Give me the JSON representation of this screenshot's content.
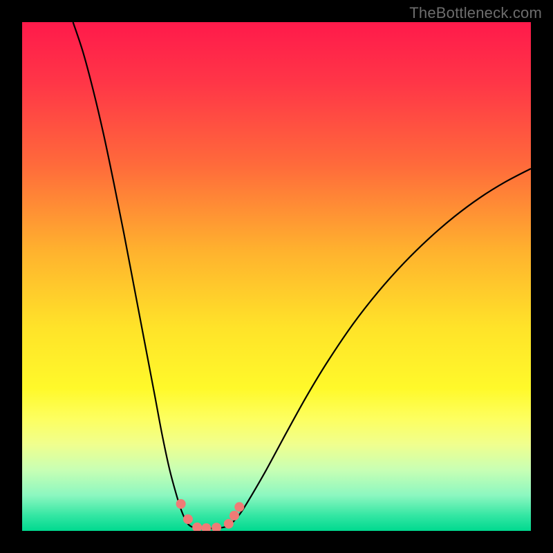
{
  "watermark": "TheBottleneck.com",
  "chart_data": {
    "type": "line",
    "title": "",
    "xlabel": "",
    "ylabel": "",
    "xlim": [
      0,
      100
    ],
    "ylim": [
      0,
      100
    ],
    "grid": false,
    "background": {
      "type": "vertical-gradient",
      "stops": [
        {
          "offset": 0.0,
          "color": "#ff1a4b"
        },
        {
          "offset": 0.12,
          "color": "#ff3647"
        },
        {
          "offset": 0.28,
          "color": "#ff6a3b"
        },
        {
          "offset": 0.45,
          "color": "#ffb22e"
        },
        {
          "offset": 0.6,
          "color": "#ffe329"
        },
        {
          "offset": 0.72,
          "color": "#fff92a"
        },
        {
          "offset": 0.78,
          "color": "#fdff60"
        },
        {
          "offset": 0.83,
          "color": "#f0ff8e"
        },
        {
          "offset": 0.88,
          "color": "#c8ffb4"
        },
        {
          "offset": 0.93,
          "color": "#8cf7c0"
        },
        {
          "offset": 0.97,
          "color": "#33e6a3"
        },
        {
          "offset": 1.0,
          "color": "#00d98f"
        }
      ]
    },
    "series": [
      {
        "name": "left-branch",
        "stroke": "#000000",
        "x": [
          10.0,
          12.0,
          14.0,
          16.0,
          18.0,
          20.0,
          22.0,
          24.0,
          26.0,
          27.5,
          29.0,
          30.5,
          31.5,
          32.5,
          33.3
        ],
        "y": [
          100.0,
          94.0,
          86.5,
          78.0,
          68.5,
          58.5,
          48.0,
          37.5,
          27.0,
          19.0,
          12.0,
          6.5,
          3.5,
          1.5,
          0.8
        ]
      },
      {
        "name": "right-branch",
        "stroke": "#000000",
        "x": [
          40.5,
          41.5,
          43.0,
          45.0,
          48.0,
          52.0,
          56.0,
          60.0,
          65.0,
          70.0,
          75.0,
          80.0,
          85.0,
          90.0,
          95.0,
          100.0
        ],
        "y": [
          0.9,
          1.8,
          3.6,
          6.8,
          12.0,
          19.4,
          26.6,
          33.2,
          40.6,
          47.0,
          52.6,
          57.5,
          61.8,
          65.5,
          68.6,
          71.2
        ]
      },
      {
        "name": "trough-floor",
        "stroke": "#000000",
        "x": [
          33.3,
          35.0,
          37.0,
          39.0,
          40.5
        ],
        "y": [
          0.8,
          0.5,
          0.5,
          0.6,
          0.9
        ]
      }
    ],
    "markers": [
      {
        "series": "trough-markers",
        "color": "#ef7b76",
        "radius": 7,
        "points": [
          {
            "x": 31.2,
            "y": 5.3
          },
          {
            "x": 32.6,
            "y": 2.3
          },
          {
            "x": 34.4,
            "y": 0.7
          },
          {
            "x": 36.2,
            "y": 0.55
          },
          {
            "x": 38.2,
            "y": 0.65
          },
          {
            "x": 40.6,
            "y": 1.4
          },
          {
            "x": 41.7,
            "y": 3.0
          },
          {
            "x": 42.7,
            "y": 4.7
          }
        ]
      }
    ]
  }
}
